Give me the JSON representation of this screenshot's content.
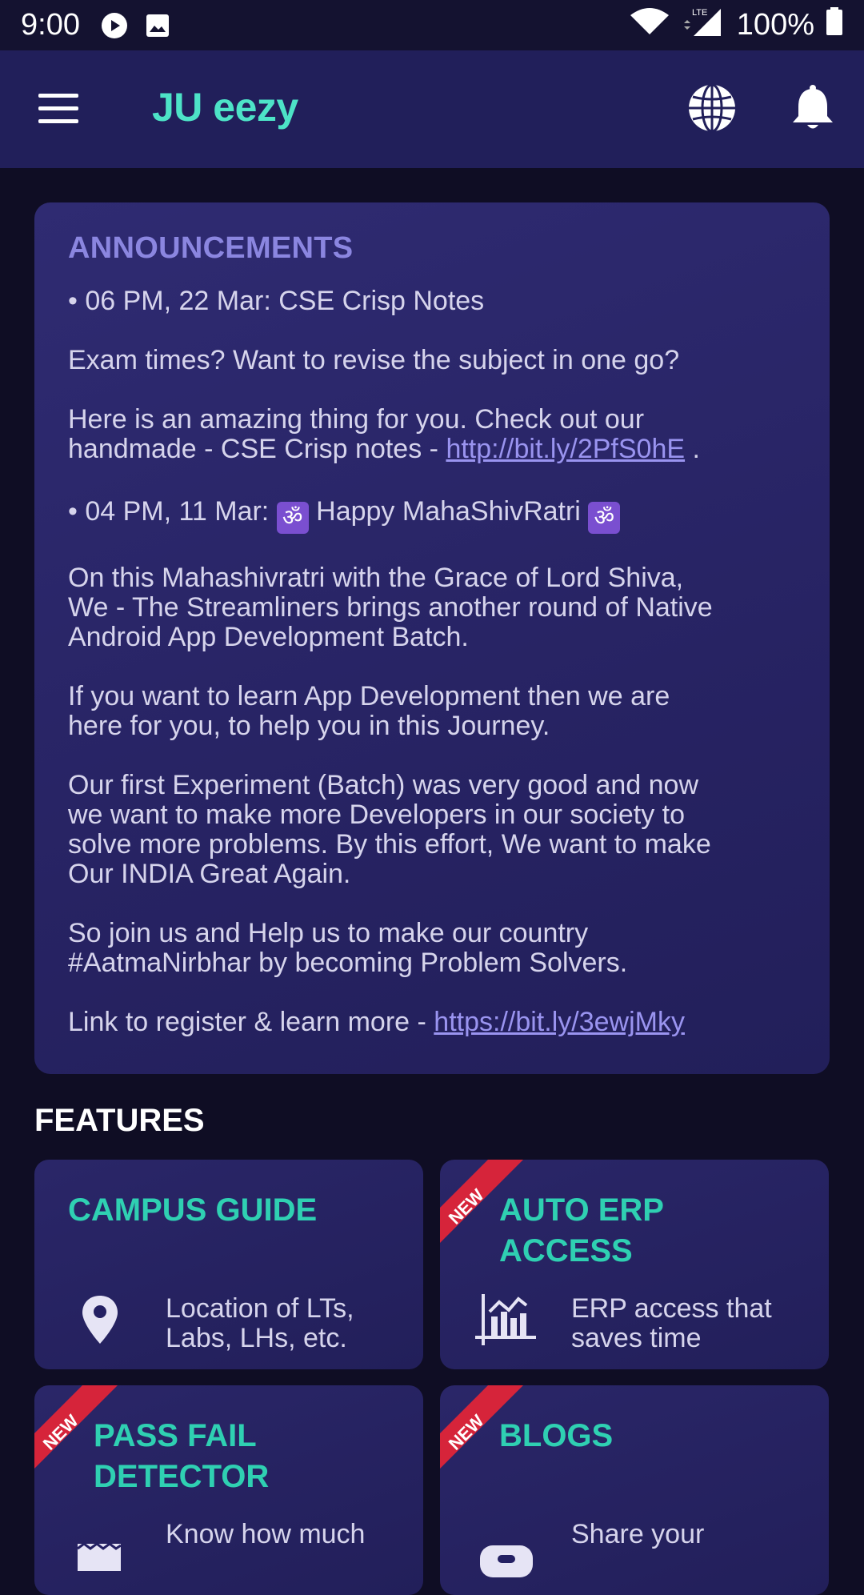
{
  "status_bar": {
    "time": "9:00",
    "battery": "100%",
    "network": "LTE"
  },
  "app_bar": {
    "title": "JU eezy"
  },
  "announcements": {
    "title": "ANNOUNCEMENTS",
    "item1_heading": "• 06 PM, 22 Mar: CSE Crisp Notes",
    "item1_p1": "Exam times? Want to revise the subject in one go?",
    "item1_p2a": "Here is an amazing thing for you. Check out our",
    "item1_p2b": "handmade - CSE Crisp notes - ",
    "item1_link": "http://bit.ly/2PfS0hE",
    "item1_p2c": " .",
    "item2_heading_a": "• 04 PM, 11 Mar: ",
    "item2_heading_b": " Happy MahaShivRatri ",
    "om_symbol": "ॐ",
    "item2_p1a": "On this Mahashivratri with the Grace of Lord Shiva,",
    "item2_p1b": "We - The Streamliners brings another round of Native",
    "item2_p1c": "Android App Development Batch.",
    "item2_p2a": "If you want to learn App Development then we are",
    "item2_p2b": "here for you, to help you in this Journey.",
    "item2_p3a": "Our first Experiment (Batch) was very good and now",
    "item2_p3b": "we want to make more Developers in our society to",
    "item2_p3c": "solve more problems. By this effort, We want to make",
    "item2_p3d": "Our INDIA Great Again.",
    "item2_p4a": "So join us and Help us to make our country",
    "item2_p4b": "#AatmaNirbhar by becoming Problem Solvers.",
    "item2_p5": "Link to register & learn more - ",
    "item2_link": "https://bit.ly/3ewjMky"
  },
  "features": {
    "title": "FEATURES",
    "ribbon_label": "NEW",
    "cards": [
      {
        "title_l1": "CAMPUS GUIDE",
        "title_l2": "",
        "desc_l1": "Location of LTs,",
        "desc_l2": "Labs, LHs, etc.",
        "icon": "location-pin-icon",
        "new": false
      },
      {
        "title_l1": "AUTO ERP",
        "title_l2": "ACCESS",
        "desc_l1": "ERP access that",
        "desc_l2": "saves time",
        "icon": "bar-chart-icon",
        "new": true
      },
      {
        "title_l1": "PASS FAIL",
        "title_l2": "DETECTOR",
        "desc_l1": "Know how much",
        "desc_l2": "",
        "icon": "receipt-icon",
        "new": true
      },
      {
        "title_l1": "BLOGS",
        "title_l2": "",
        "desc_l1": "Share your",
        "desc_l2": "",
        "icon": "blog-icon",
        "new": true
      }
    ]
  },
  "colors": {
    "background": "#0f0d24",
    "app_bar": "#211f5a",
    "accent_teal": "#4de3c7",
    "card_title": "#2fd0b2",
    "announce_title": "#8b86e0",
    "ribbon_red": "#d6243a"
  }
}
